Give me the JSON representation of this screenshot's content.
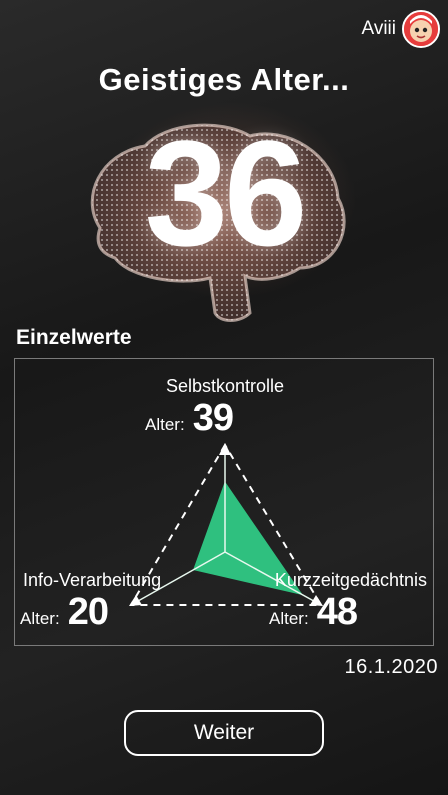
{
  "user": {
    "name": "Aviii"
  },
  "header": {
    "title": "Geistiges Alter..."
  },
  "result": {
    "brain_age": "36"
  },
  "breakdown": {
    "section_title": "Einzelwerte",
    "age_prefix": "Alter:",
    "categories": [
      {
        "label": "Selbstkontrolle",
        "age": "39"
      },
      {
        "label": "Info-Verarbeitung",
        "age": "20"
      },
      {
        "label": "Kurzzeitgedächtnis",
        "age": "48"
      }
    ],
    "chart_color": "#2fc07f"
  },
  "date": "16.1.2020",
  "continue_label": "Weiter",
  "chart_data": {
    "type": "radar",
    "categories": [
      "Selbstkontrolle",
      "Info-Verarbeitung",
      "Kurzzeitgedächtnis"
    ],
    "values": [
      39,
      20,
      48
    ]
  }
}
